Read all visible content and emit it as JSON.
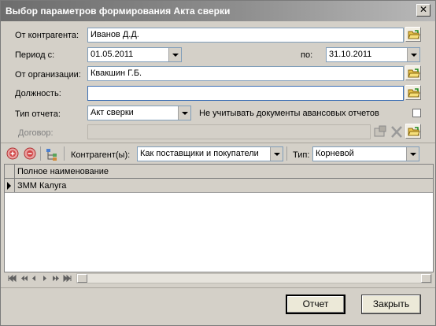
{
  "window": {
    "title": "Выбор параметров формирования Акта сверки",
    "close_glyph": "✕"
  },
  "form": {
    "counterparty": {
      "label": "От контрагента:",
      "value": "Иванов Д.Д."
    },
    "period": {
      "label": "Период с:",
      "from": "01.05.2011",
      "to_label": "по:",
      "to": "31.10.2011"
    },
    "organization": {
      "label": "От организации:",
      "value": "Квакшин Г.Б."
    },
    "position": {
      "label": "Должность:",
      "value": ""
    },
    "report_type": {
      "label": "Тип отчета:",
      "value": "Акт сверки"
    },
    "ignore_advance": {
      "label": "Не учитывать документы авансовых отчетов",
      "checked": false
    },
    "contract": {
      "label": "Договор:",
      "value": ""
    }
  },
  "toolbar": {
    "counterparty_label": "Контрагент(ы):",
    "counterparty_value": "Как поставщики и покупатели",
    "type_label": "Тип:",
    "type_value": "Корневой"
  },
  "grid": {
    "columns": [
      "Полное наименование"
    ],
    "rows": [
      {
        "name": "ЗММ Калуга"
      }
    ]
  },
  "buttons": {
    "ok": "Отчет",
    "close": "Закрыть"
  },
  "icons": {
    "folder": "folder-open-icon",
    "add": "add-circle-icon",
    "remove": "remove-circle-icon",
    "hierarchy": "hierarchy-icon",
    "clear": "clear-x-icon",
    "select": "select-list-icon"
  }
}
